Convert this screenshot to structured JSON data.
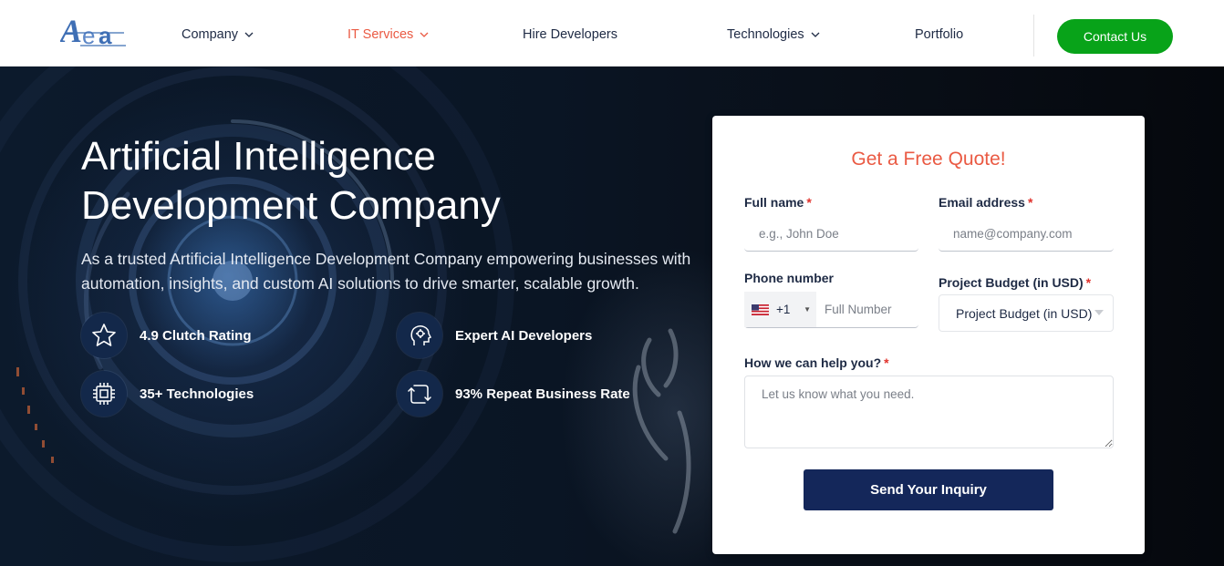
{
  "brand": {
    "logo_text": "Aea",
    "accent": "#ea5a43",
    "primary": "#14275a",
    "cta_green": "#08a319"
  },
  "nav": {
    "items": [
      {
        "label": "Company",
        "has_dropdown": true,
        "active": false
      },
      {
        "label": "IT Services",
        "has_dropdown": true,
        "active": true
      },
      {
        "label": "Hire Developers",
        "has_dropdown": false,
        "active": false
      },
      {
        "label": "Technologies",
        "has_dropdown": true,
        "active": false
      },
      {
        "label": "Portfolio",
        "has_dropdown": false,
        "active": false
      }
    ],
    "contact_label": "Contact Us"
  },
  "hero": {
    "title_line1": "Artificial Intelligence",
    "title_line2": "Development Company",
    "description": "As a trusted Artificial Intelligence Development Company empowering businesses with automation, insights, and custom AI solutions to drive smarter, scalable growth.",
    "features": [
      {
        "label": "4.9 Clutch Rating",
        "icon": "star-icon"
      },
      {
        "label": "Expert AI Developers",
        "icon": "ai-head-icon"
      },
      {
        "label": "35+ Technologies",
        "icon": "chip-icon"
      },
      {
        "label": "93% Repeat Business Rate",
        "icon": "repeat-icon"
      }
    ]
  },
  "form": {
    "title": "Get a Free Quote!",
    "full_name": {
      "label": "Full name",
      "placeholder": "e.g., John Doe"
    },
    "email": {
      "label": "Email address",
      "placeholder": "name@company.com"
    },
    "phone": {
      "label": "Phone number",
      "country_code": "+1",
      "flag": "us-flag-icon",
      "placeholder": "Full Number"
    },
    "budget": {
      "label": "Project Budget (in USD)",
      "selected": "Project Budget (in USD)"
    },
    "help": {
      "label": "How we can help you?",
      "placeholder": "Let us know what you need."
    },
    "required_mark": "*",
    "submit_label": "Send Your Inquiry"
  }
}
